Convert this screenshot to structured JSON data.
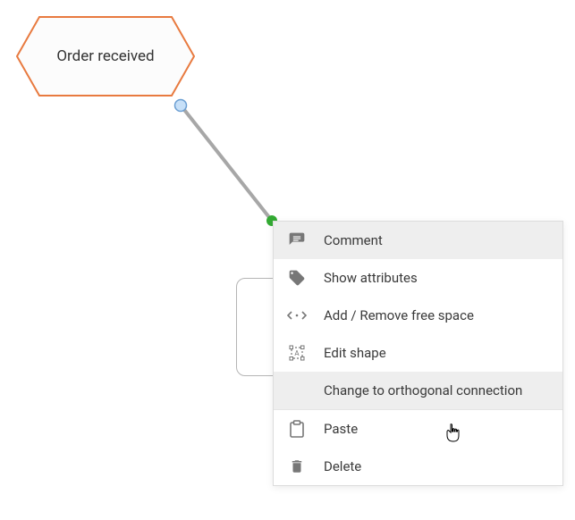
{
  "node": {
    "label": "Order received"
  },
  "menu": {
    "items": [
      {
        "label": "Comment"
      },
      {
        "label": "Show attributes"
      },
      {
        "label": "Add / Remove free space"
      },
      {
        "label": "Edit shape"
      },
      {
        "label": "Change to orthogonal connection"
      },
      {
        "label": "Paste"
      },
      {
        "label": "Delete"
      }
    ]
  },
  "colors": {
    "accent": "#e87a3f",
    "connector": "#a7a7a7",
    "endpoint_fill": "#c7e0f8",
    "endpoint_stroke": "#6a9ed2",
    "arrow_fill": "#33aa33"
  }
}
